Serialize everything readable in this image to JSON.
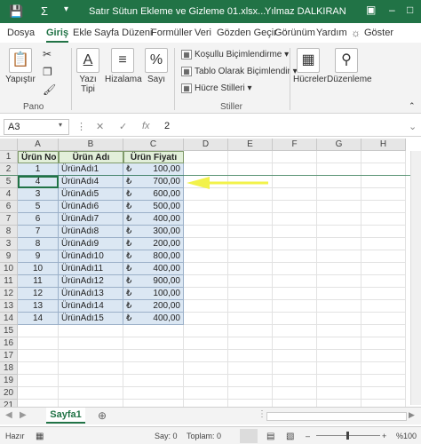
{
  "titlebar": {
    "title": "Satır Sütun Ekleme ve Gizleme 01.xlsx...",
    "user": "Yılmaz DALKIRAN",
    "save_icon": "save-icon",
    "sum_icon": "Σ"
  },
  "tabs": [
    "Dosya",
    "Giriş",
    "Ekle",
    "Sayfa Düzeni",
    "Formüller",
    "Veri",
    "Gözden Geçir",
    "Görünüm",
    "Yardım"
  ],
  "tell_me": "Göster",
  "ribbon": {
    "paste": "Yapıştır",
    "font": "Yazı Tipi",
    "align": "Hizalama",
    "number": "Sayı",
    "number_symbol": "%",
    "cond_format": "Koşullu Biçimlendirme",
    "format_table": "Tablo Olarak Biçimlendir",
    "cell_styles": "Hücre Stilleri",
    "cells": "Hücreler",
    "editing": "Düzenleme",
    "group_clipboard": "Pano",
    "group_styles": "Stiller"
  },
  "formula_bar": {
    "name_box": "A3",
    "fx": "fx",
    "value": "2"
  },
  "columns": [
    "A",
    "B",
    "C",
    "D",
    "E",
    "F",
    "G",
    "H"
  ],
  "rows": [
    "1",
    "2",
    "5",
    "4",
    "6",
    "7",
    "8",
    "3",
    "9",
    "10",
    "11",
    "12",
    "13",
    "14",
    "15",
    "16",
    "17",
    "18",
    "19",
    "20",
    "21",
    "22"
  ],
  "table": {
    "headers": [
      "Ürün No",
      "Ürün Adı",
      "Ürün Fiyatı"
    ],
    "currency_symbol": "₺",
    "rows": [
      [
        "1",
        "ÜrünAdı1",
        "100,00"
      ],
      [
        "4",
        "ÜrünAdı4",
        "700,00"
      ],
      [
        "3",
        "ÜrünAdı5",
        "600,00"
      ],
      [
        "5",
        "ÜrünAdı6",
        "500,00"
      ],
      [
        "6",
        "ÜrünAdı7",
        "400,00"
      ],
      [
        "7",
        "ÜrünAdı8",
        "300,00"
      ],
      [
        "8",
        "ÜrünAdı9",
        "200,00"
      ],
      [
        "9",
        "ÜrünAdı10",
        "800,00"
      ],
      [
        "10",
        "ÜrünAdı11",
        "400,00"
      ],
      [
        "11",
        "ÜrünAdı12",
        "900,00"
      ],
      [
        "12",
        "ÜrünAdı13",
        "100,00"
      ],
      [
        "13",
        "ÜrünAdı14",
        "200,00"
      ],
      [
        "14",
        "ÜrünAdı15",
        "400,00"
      ]
    ]
  },
  "sheet_tab": "Sayfa1",
  "status": {
    "ready": "Hazır",
    "count": "Say: 0",
    "sum": "Toplam: 0",
    "zoom": "%100"
  },
  "colors": {
    "accent": "#217346",
    "table_fill": "#dbe7f3",
    "header_fill": "#e2efda",
    "arrow": "#f2f24a"
  }
}
